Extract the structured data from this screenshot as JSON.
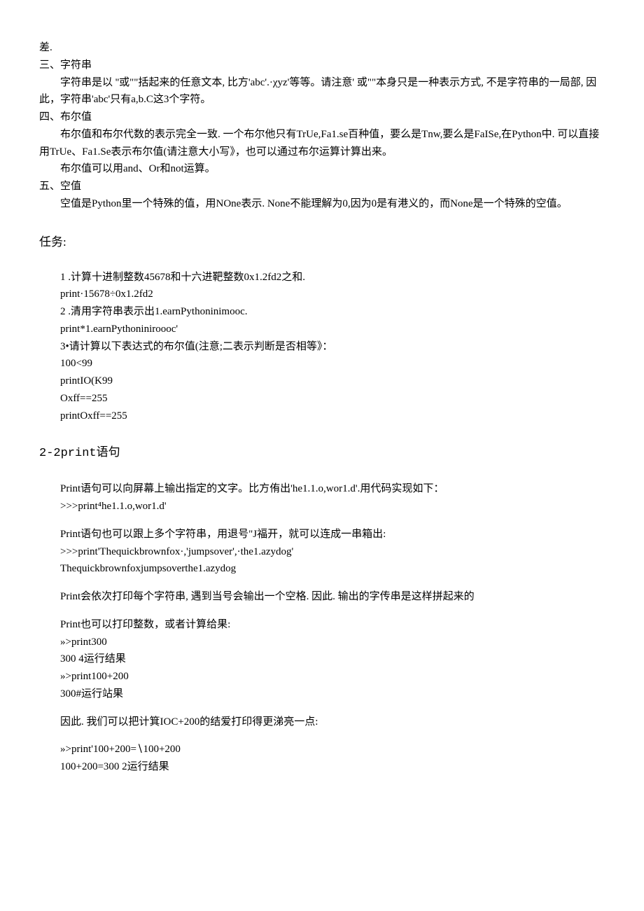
{
  "intro": {
    "p1": "差.",
    "h3": "三、字符串",
    "p3": "字符串是以 ''或\"\"括起来的任意文本, 比方'abc'.·χyz'等等。请注意' 或\"\"本身只是一种表示方式, 不是字符串的一局部, 因此，字符串'abc'只有a,b.C这3个字符。",
    "h4": "四、布尔值",
    "p4a": "布尔值和布尔代数的表示完全一致. 一个布尔他只有TrUe,Fa1.se百种值，要么是Tnw,要么是FaISe,在Python中. 可以直接用TrUe、Fa1.Se表示布尔值(请注意大小写》，也可以通过布尔运算计算出来。",
    "p4b": "布尔值可以用and、Or和not运算。",
    "h5": "五、空值",
    "p5": "空值是Python里一个特殊的值，用NOne表示. None不能理解为0,因为0是有港义的，而None是一个特殊的空值。"
  },
  "task_heading": "任务:",
  "tasks": {
    "t1": "1  .计算十进制整数45678和十六进靶整数0x1.2fd2之和.",
    "t1code": "print·15678÷0x1.2fd2",
    "t2": "2  .清用字符串表示出1.earnPythoninimooc.",
    "t2code": "print*1.earnPythoniniroooc'",
    "t3": "3•请计算以下表达式的布尔值(注意;二表示判断是否相等》：",
    "t3a": "100<99",
    "t3b": "printIO(K99",
    "t3c": "Oxff==255",
    "t3d": "printOxff==255"
  },
  "sub_heading": "2-2print语句",
  "section2": {
    "s1a": "Print语句可以向屏幕上输出指定的文字。比方侑出'he1.1.o,wor1.d'.用代码实现如下：",
    "s1b": ">>>print⁴he1.1.o,wor1.d'",
    "s2a": "Print语句也可以跟上多个字符串，用退号\"J福开，就可以连成一串箱出:",
    "s2b": ">>>print'Thequickbrownfox·,'jumpsover',·the1.azydog'",
    "s2c": "Thequickbrownfoxjumpsoverthe1.azydog",
    "s3": "Print会依次打印每个字符串, 遇到当号会输出一个空格. 因此. 输出的字传串是这样拼起来的",
    "s4a": "Print也可以打印整数，或者计算给果:",
    "s4b": "»>print300",
    "s4c": "300      4运行结果",
    "s4d": "»>print100+200",
    "s4e": "300#运行站果",
    "s5": "因此. 我们可以把计箕IOC+200的结爱打印得更涕亮一点:",
    "s6a": "»>print'100+200=∖100+200",
    "s6b": "100+200=300              2运行结果"
  }
}
